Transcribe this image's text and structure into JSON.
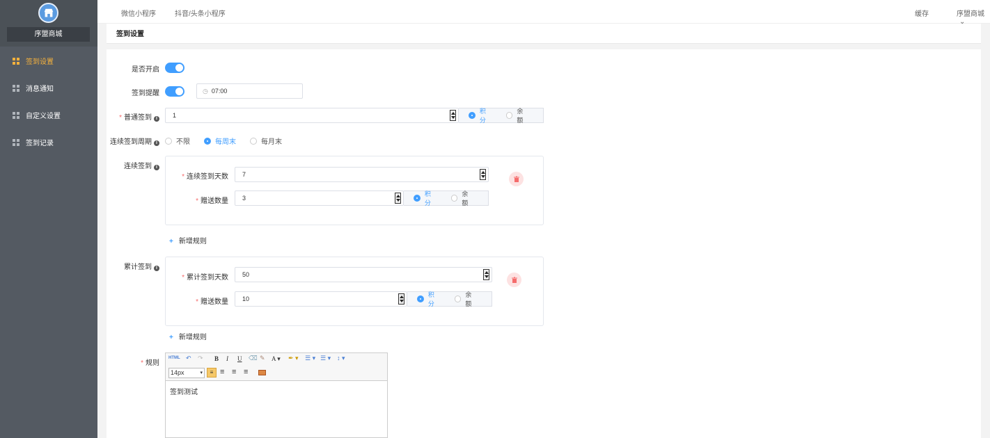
{
  "sidebar": {
    "shop_name": "序盟商城",
    "items": [
      {
        "label": "签到设置",
        "active": true
      },
      {
        "label": "消息通知",
        "active": false
      },
      {
        "label": "自定义设置",
        "active": false
      },
      {
        "label": "签到记录",
        "active": false
      }
    ]
  },
  "topbar": {
    "tabs": [
      "微信小程序",
      "抖音/头条小程序"
    ],
    "cache": "缓存",
    "account": "序盟商城"
  },
  "page_title": "签到设置",
  "form": {
    "enable_label": "是否开启",
    "remind_label": "签到提醒",
    "remind_time": "07:00",
    "normal_label": "普通签到",
    "normal_value": "1",
    "reward_points": "积分",
    "reward_balance": "余额",
    "cycle_label": "连续签到周期",
    "cycle_options": [
      "不限",
      "每周末",
      "每月末"
    ],
    "cycle_selected": "每周末",
    "continuous_label": "连续签到",
    "continuous_days_label": "连续签到天数",
    "continuous_days": "7",
    "gift_label": "赠送数量",
    "continuous_gift": "3",
    "add_rule": "新增规则",
    "cumulative_label": "累计签到",
    "cumulative_days_label": "累计签到天数",
    "cumulative_days": "50",
    "cumulative_gift": "10",
    "rules_label": "规则",
    "editor_font_size": "14px",
    "editor_content": "签到测试"
  },
  "colors": {
    "accent": "#409eff",
    "sidebar_bg": "#545a62",
    "active_nav": "#f5b13d",
    "danger": "#f56c6c"
  }
}
